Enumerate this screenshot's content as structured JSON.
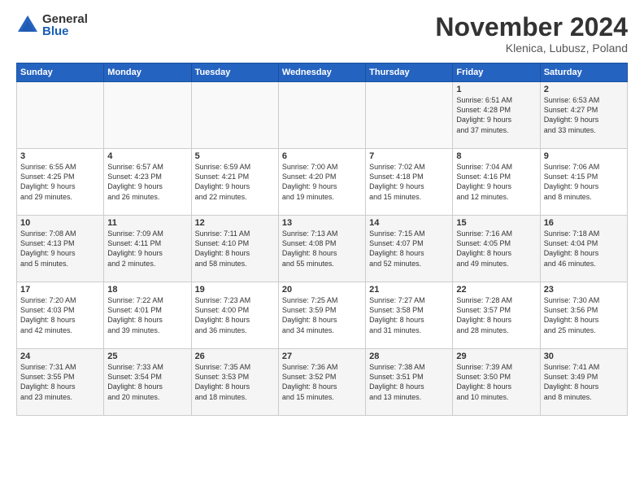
{
  "logo": {
    "general": "General",
    "blue": "Blue"
  },
  "header": {
    "month": "November 2024",
    "location": "Klenica, Lubusz, Poland"
  },
  "weekdays": [
    "Sunday",
    "Monday",
    "Tuesday",
    "Wednesday",
    "Thursday",
    "Friday",
    "Saturday"
  ],
  "weeks": [
    [
      {
        "day": "",
        "info": ""
      },
      {
        "day": "",
        "info": ""
      },
      {
        "day": "",
        "info": ""
      },
      {
        "day": "",
        "info": ""
      },
      {
        "day": "",
        "info": ""
      },
      {
        "day": "1",
        "info": "Sunrise: 6:51 AM\nSunset: 4:28 PM\nDaylight: 9 hours\nand 37 minutes."
      },
      {
        "day": "2",
        "info": "Sunrise: 6:53 AM\nSunset: 4:27 PM\nDaylight: 9 hours\nand 33 minutes."
      }
    ],
    [
      {
        "day": "3",
        "info": "Sunrise: 6:55 AM\nSunset: 4:25 PM\nDaylight: 9 hours\nand 29 minutes."
      },
      {
        "day": "4",
        "info": "Sunrise: 6:57 AM\nSunset: 4:23 PM\nDaylight: 9 hours\nand 26 minutes."
      },
      {
        "day": "5",
        "info": "Sunrise: 6:59 AM\nSunset: 4:21 PM\nDaylight: 9 hours\nand 22 minutes."
      },
      {
        "day": "6",
        "info": "Sunrise: 7:00 AM\nSunset: 4:20 PM\nDaylight: 9 hours\nand 19 minutes."
      },
      {
        "day": "7",
        "info": "Sunrise: 7:02 AM\nSunset: 4:18 PM\nDaylight: 9 hours\nand 15 minutes."
      },
      {
        "day": "8",
        "info": "Sunrise: 7:04 AM\nSunset: 4:16 PM\nDaylight: 9 hours\nand 12 minutes."
      },
      {
        "day": "9",
        "info": "Sunrise: 7:06 AM\nSunset: 4:15 PM\nDaylight: 9 hours\nand 8 minutes."
      }
    ],
    [
      {
        "day": "10",
        "info": "Sunrise: 7:08 AM\nSunset: 4:13 PM\nDaylight: 9 hours\nand 5 minutes."
      },
      {
        "day": "11",
        "info": "Sunrise: 7:09 AM\nSunset: 4:11 PM\nDaylight: 9 hours\nand 2 minutes."
      },
      {
        "day": "12",
        "info": "Sunrise: 7:11 AM\nSunset: 4:10 PM\nDaylight: 8 hours\nand 58 minutes."
      },
      {
        "day": "13",
        "info": "Sunrise: 7:13 AM\nSunset: 4:08 PM\nDaylight: 8 hours\nand 55 minutes."
      },
      {
        "day": "14",
        "info": "Sunrise: 7:15 AM\nSunset: 4:07 PM\nDaylight: 8 hours\nand 52 minutes."
      },
      {
        "day": "15",
        "info": "Sunrise: 7:16 AM\nSunset: 4:05 PM\nDaylight: 8 hours\nand 49 minutes."
      },
      {
        "day": "16",
        "info": "Sunrise: 7:18 AM\nSunset: 4:04 PM\nDaylight: 8 hours\nand 46 minutes."
      }
    ],
    [
      {
        "day": "17",
        "info": "Sunrise: 7:20 AM\nSunset: 4:03 PM\nDaylight: 8 hours\nand 42 minutes."
      },
      {
        "day": "18",
        "info": "Sunrise: 7:22 AM\nSunset: 4:01 PM\nDaylight: 8 hours\nand 39 minutes."
      },
      {
        "day": "19",
        "info": "Sunrise: 7:23 AM\nSunset: 4:00 PM\nDaylight: 8 hours\nand 36 minutes."
      },
      {
        "day": "20",
        "info": "Sunrise: 7:25 AM\nSunset: 3:59 PM\nDaylight: 8 hours\nand 34 minutes."
      },
      {
        "day": "21",
        "info": "Sunrise: 7:27 AM\nSunset: 3:58 PM\nDaylight: 8 hours\nand 31 minutes."
      },
      {
        "day": "22",
        "info": "Sunrise: 7:28 AM\nSunset: 3:57 PM\nDaylight: 8 hours\nand 28 minutes."
      },
      {
        "day": "23",
        "info": "Sunrise: 7:30 AM\nSunset: 3:56 PM\nDaylight: 8 hours\nand 25 minutes."
      }
    ],
    [
      {
        "day": "24",
        "info": "Sunrise: 7:31 AM\nSunset: 3:55 PM\nDaylight: 8 hours\nand 23 minutes."
      },
      {
        "day": "25",
        "info": "Sunrise: 7:33 AM\nSunset: 3:54 PM\nDaylight: 8 hours\nand 20 minutes."
      },
      {
        "day": "26",
        "info": "Sunrise: 7:35 AM\nSunset: 3:53 PM\nDaylight: 8 hours\nand 18 minutes."
      },
      {
        "day": "27",
        "info": "Sunrise: 7:36 AM\nSunset: 3:52 PM\nDaylight: 8 hours\nand 15 minutes."
      },
      {
        "day": "28",
        "info": "Sunrise: 7:38 AM\nSunset: 3:51 PM\nDaylight: 8 hours\nand 13 minutes."
      },
      {
        "day": "29",
        "info": "Sunrise: 7:39 AM\nSunset: 3:50 PM\nDaylight: 8 hours\nand 10 minutes."
      },
      {
        "day": "30",
        "info": "Sunrise: 7:41 AM\nSunset: 3:49 PM\nDaylight: 8 hours\nand 8 minutes."
      }
    ]
  ]
}
